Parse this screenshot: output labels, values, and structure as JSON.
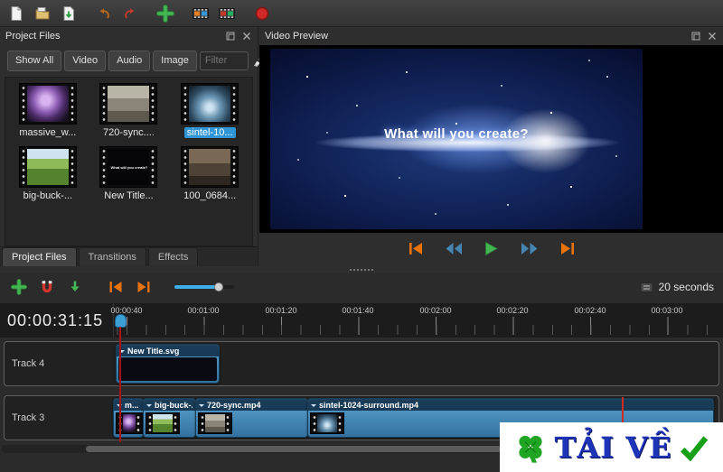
{
  "toolbar": {
    "icons": [
      "new-project",
      "open-project",
      "save-project",
      "undo",
      "redo",
      "import-files",
      "choose-profile",
      "animated-title",
      "export-video"
    ]
  },
  "project_files": {
    "title": "Project Files",
    "filters": [
      {
        "label": "Show All"
      },
      {
        "label": "Video"
      },
      {
        "label": "Audio"
      },
      {
        "label": "Image"
      }
    ],
    "filter_placeholder": "Filter",
    "files": [
      {
        "label": "massive_w..."
      },
      {
        "label": "720-sync...."
      },
      {
        "label": "sintel-10...",
        "selected": true
      },
      {
        "label": "big-buck-..."
      },
      {
        "label": "New Title...",
        "caption": "What will you create?"
      },
      {
        "label": "100_0684..."
      }
    ],
    "tabs": [
      {
        "label": "Project Files",
        "active": true
      },
      {
        "label": "Transitions"
      },
      {
        "label": "Effects"
      }
    ]
  },
  "video_preview": {
    "title": "Video Preview",
    "overlay_text": "What will you create?"
  },
  "timeline": {
    "timecode": "00:00:31:15",
    "zoom_label": "20 seconds",
    "ruler_labels": [
      "00:00:40",
      "00:01:00",
      "00:01:20",
      "00:01:40",
      "00:02:00",
      "00:02:20",
      "00:02:40",
      "00:03:00"
    ],
    "tracks": [
      {
        "name": "Track 4",
        "clips": [
          {
            "label": "New Title.svg"
          }
        ]
      },
      {
        "name": "Track 3",
        "clips": [
          {
            "label": "m..."
          },
          {
            "label": "big-buck-..."
          },
          {
            "label": "720-sync.mp4"
          },
          {
            "label": "sintel-1024-surround.mp4"
          }
        ]
      }
    ]
  },
  "watermark": {
    "text": "TẢI VỀ"
  }
}
